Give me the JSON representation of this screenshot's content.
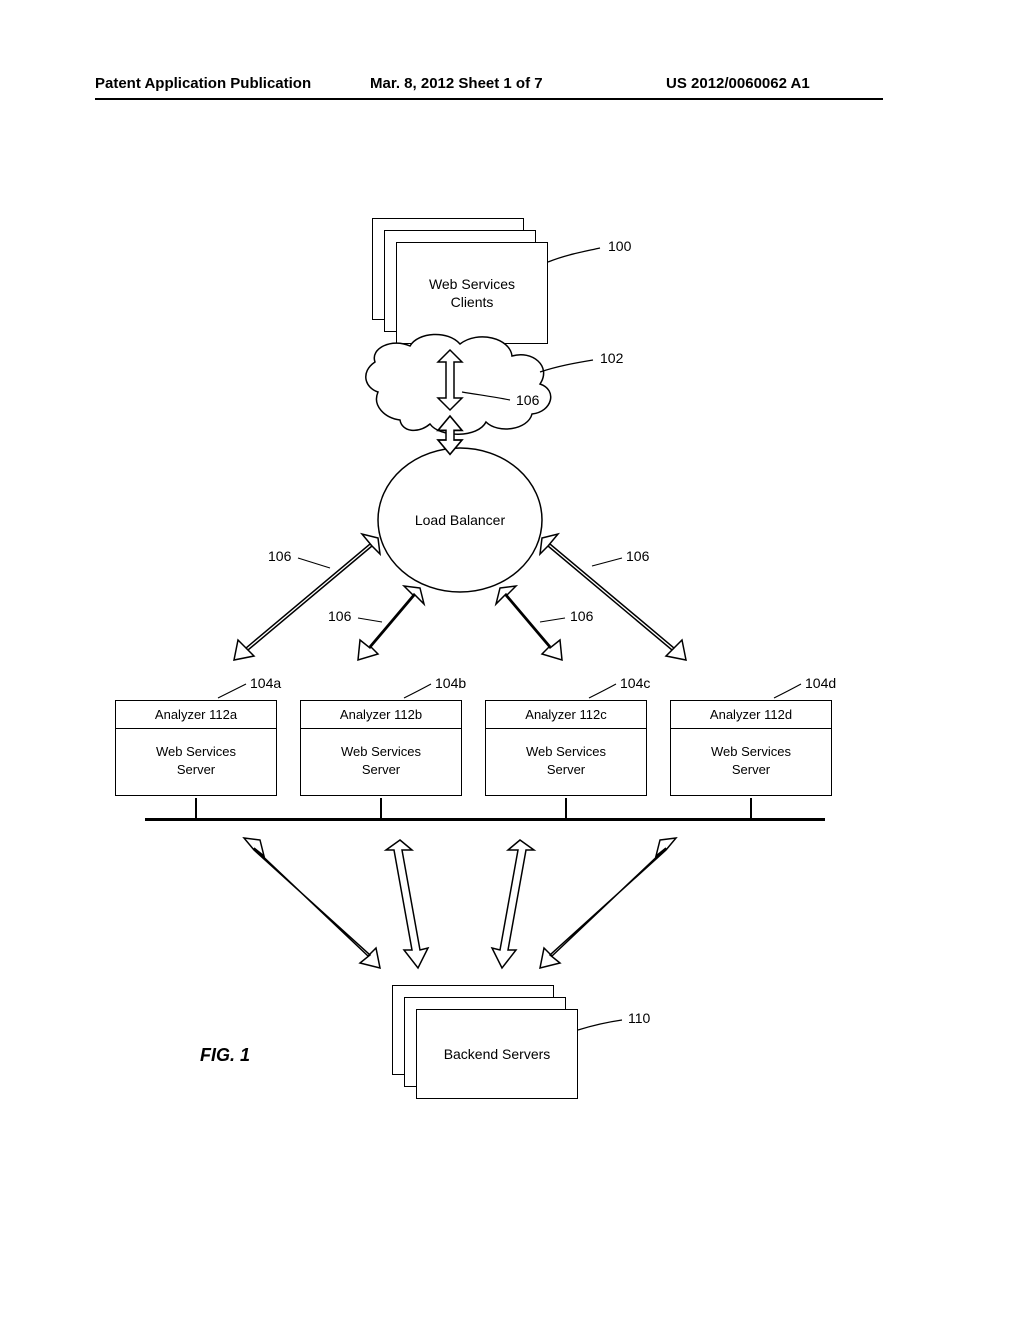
{
  "header": {
    "left": "Patent Application Publication",
    "middle": "Mar. 8, 2012  Sheet 1 of 7",
    "right": "US 2012/0060062 A1"
  },
  "figure_caption": "FIG. 1",
  "clients": {
    "label": "Web Services\nClients",
    "ref": "100"
  },
  "cloud": {
    "ref": "102",
    "arrow_ref": "106"
  },
  "load_balancer": {
    "label": "Load Balancer",
    "arrow_refs": [
      "106",
      "106",
      "106",
      "106"
    ]
  },
  "servers": [
    {
      "ref": "104a",
      "analyzer": "Analyzer 112a",
      "server": "Web Services\nServer"
    },
    {
      "ref": "104b",
      "analyzer": "Analyzer 112b",
      "server": "Web Services\nServer"
    },
    {
      "ref": "104c",
      "analyzer": "Analyzer 112c",
      "server": "Web Services\nServer"
    },
    {
      "ref": "104d",
      "analyzer": "Analyzer 112d",
      "server": "Web Services\nServer"
    }
  ],
  "backend": {
    "label": "Backend Servers",
    "ref": "110"
  }
}
